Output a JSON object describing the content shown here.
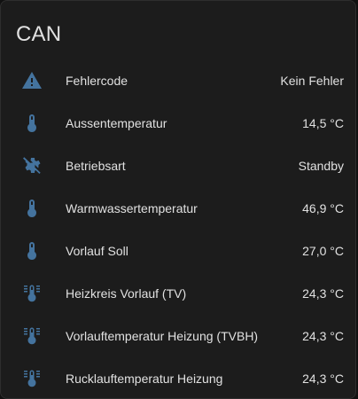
{
  "card": {
    "title": "CAN",
    "icon_color": "#44739e",
    "rows": [
      {
        "icon": "alert-icon",
        "label": "Fehlercode",
        "value": "Kein Fehler"
      },
      {
        "icon": "thermometer-icon",
        "label": "Aussentemperatur",
        "value": "14,5 °C"
      },
      {
        "icon": "cog-off-icon",
        "label": "Betriebsart",
        "value": "Standby"
      },
      {
        "icon": "thermometer-icon",
        "label": "Warmwassertemperatur",
        "value": "46,9 °C"
      },
      {
        "icon": "thermometer-icon",
        "label": "Vorlauf Soll",
        "value": "27,0 °C"
      },
      {
        "icon": "thermometer-lines-icon",
        "label": "Heizkreis Vorlauf (TV)",
        "value": "24,3 °C"
      },
      {
        "icon": "thermometer-lines-icon",
        "label": "Vorlauftemperatur Heizung (TVBH)",
        "value": "24,3 °C"
      },
      {
        "icon": "thermometer-lines-icon",
        "label": "Rucklauftemperatur Heizung",
        "value": "24,3 °C"
      }
    ]
  }
}
